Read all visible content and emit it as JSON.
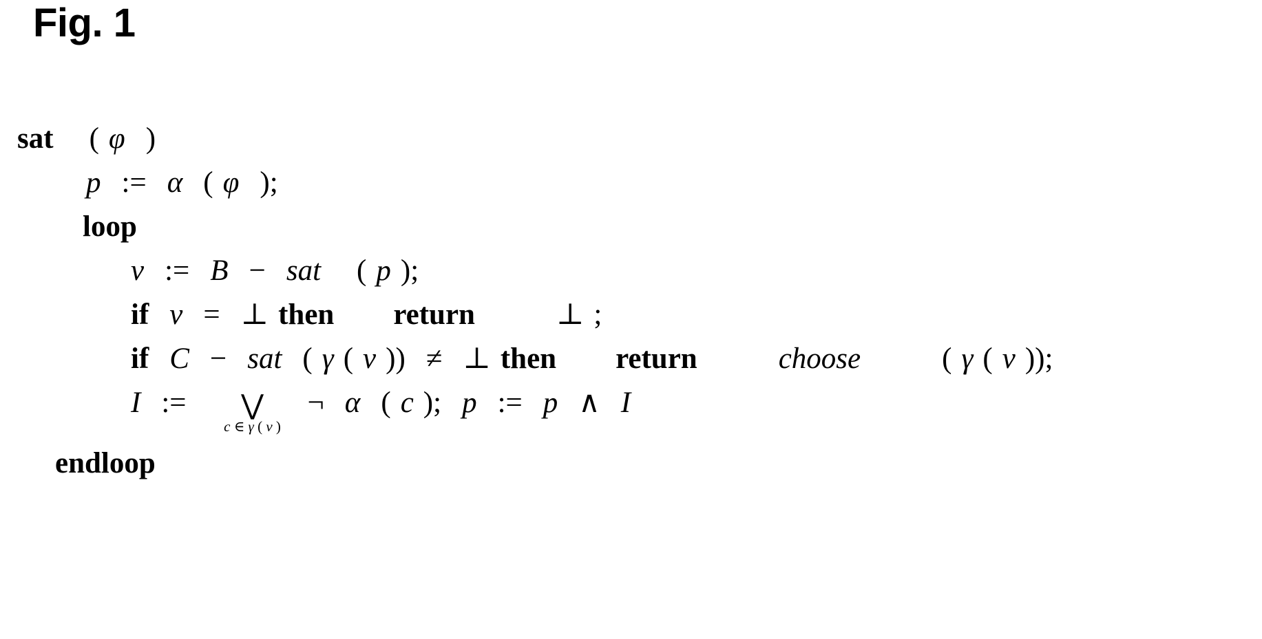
{
  "figure": {
    "title": "Fig. 1",
    "background_color": "#ffffff",
    "text_color": "#000000"
  },
  "pseudocode": {
    "lines": [
      {
        "id": "line-signature",
        "indent": "indent-0",
        "text": "sat  ( φ )",
        "tokens": {
          "kw_sat": "sat",
          "paren_open": "(",
          "phi": "φ",
          "paren_close": ")"
        }
      },
      {
        "id": "line-init-p",
        "indent": "indent-1",
        "text": "p  :=  α ( φ );",
        "tokens": {
          "var_p": "p",
          "assign": ":=",
          "alpha": "α",
          "paren_open": "(",
          "phi": "φ",
          "paren_close": ")",
          "semicolon": ";"
        }
      },
      {
        "id": "line-loop",
        "indent": "indent-2",
        "text": "loop",
        "tokens": {
          "kw_loop": "loop"
        }
      },
      {
        "id": "line-assign-nu",
        "indent": "indent-3",
        "text": "ν  :=  B  −  sat  ( p );",
        "tokens": {
          "nu": "ν",
          "assign": ":=",
          "var_B": "B",
          "minus": "−",
          "fn_sat": "sat",
          "paren_open": "(",
          "var_p": "p",
          "paren_close": ")",
          "semicolon": ";"
        }
      },
      {
        "id": "line-if-nu-bottom",
        "indent": "indent-3",
        "text": "if ν  =  ⊥ then    return     ⊥ ;",
        "tokens": {
          "kw_if": "if",
          "nu": "ν",
          "equals": "=",
          "bottom": "⊥",
          "kw_then": "then",
          "kw_return": "return",
          "bottom2": "⊥",
          "semicolon": ";"
        }
      },
      {
        "id": "line-if-csat",
        "indent": "indent-3",
        "text": "if  C  −  sat  ( γ ( ν ))  ≠  ⊥ then    return     choose     ( γ ( ν ));",
        "tokens": {
          "kw_if": "if",
          "var_C": "C",
          "minus": "−",
          "fn_sat": "sat",
          "paren_open": "(",
          "gamma": "γ",
          "paren_open2": "(",
          "nu": "ν",
          "paren_close2": ")",
          "paren_close": ")",
          "neq": "≠",
          "bottom": "⊥",
          "kw_then": "then",
          "kw_return": "return",
          "fn_choose": "choose",
          "paren_open3": "(",
          "gamma2": "γ",
          "paren_open4": "(",
          "nu2": "ν",
          "paren_close4": ")",
          "paren_close3": ")",
          "semicolon": ";"
        }
      },
      {
        "id": "line-assign-I",
        "indent": "indent-3",
        "text": "I  :=  ⋁ c ∈ γ ( ν )  ¬ α ( c );  p  :=  p  ∧  I",
        "tokens": {
          "var_I": "I",
          "assign": ":=",
          "bigvee": "⋁",
          "limit_c": "c",
          "limit_in": "∈",
          "limit_gamma": "γ",
          "limit_paren_open": "(",
          "limit_nu": "ν",
          "limit_paren_close": ")",
          "negation": "¬",
          "alpha": "α",
          "paren_open": "(",
          "var_c": "c",
          "paren_close": ")",
          "semicolon": ";",
          "var_p": "p",
          "assign2": ":=",
          "var_p2": "p",
          "wedge": "∧",
          "var_I2": "I"
        }
      },
      {
        "id": "line-endloop",
        "indent": "indent-4",
        "text": "endloop",
        "tokens": {
          "kw_endloop": "endloop"
        }
      }
    ]
  }
}
